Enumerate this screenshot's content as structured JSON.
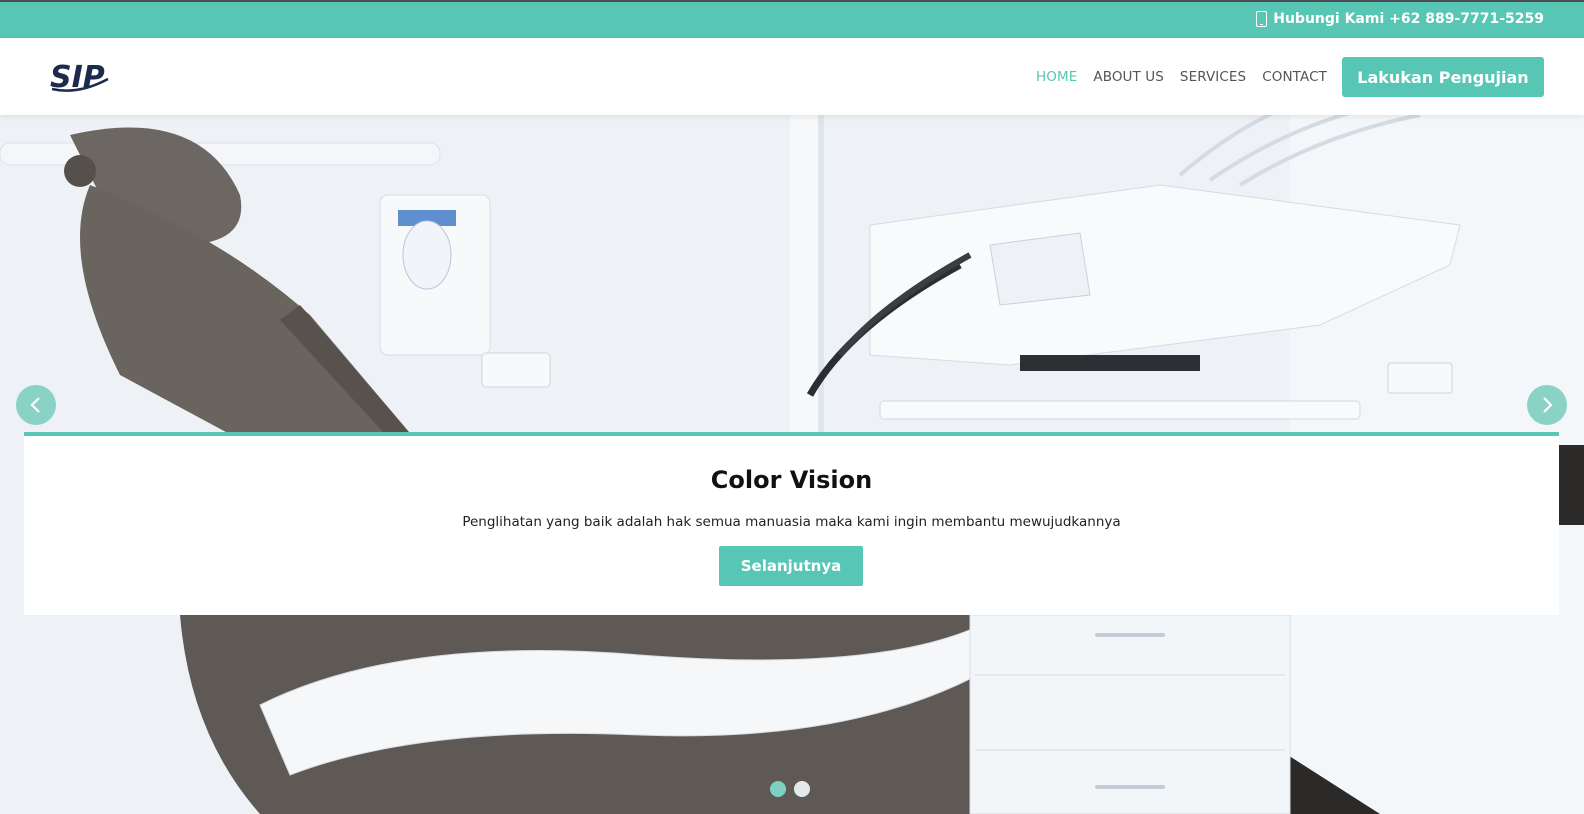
{
  "topbar": {
    "contact_label": "Hubungi Kami +62 889-7771-5259",
    "icon": "phone-icon"
  },
  "header": {
    "logo_text": "SIP",
    "nav": [
      {
        "label": "HOME",
        "active": true
      },
      {
        "label": "ABOUT US",
        "active": false
      },
      {
        "label": "SERVICES",
        "active": false
      },
      {
        "label": "CONTACT",
        "active": false
      }
    ],
    "cta_label": "Lakukan Pengujian"
  },
  "hero": {
    "slide_title": "Color Vision",
    "slide_text": "Penglihatan yang baik adalah hak semua manuasia maka kami ingin membantu mewujudkannya",
    "slide_button": "Selanjutnya",
    "prev_icon": "chevron-left-icon",
    "next_icon": "chevron-right-icon",
    "slide_count": 2,
    "active_slide": 1
  },
  "colors": {
    "accent": "#58c6b5",
    "logo": "#1c2a4d"
  }
}
